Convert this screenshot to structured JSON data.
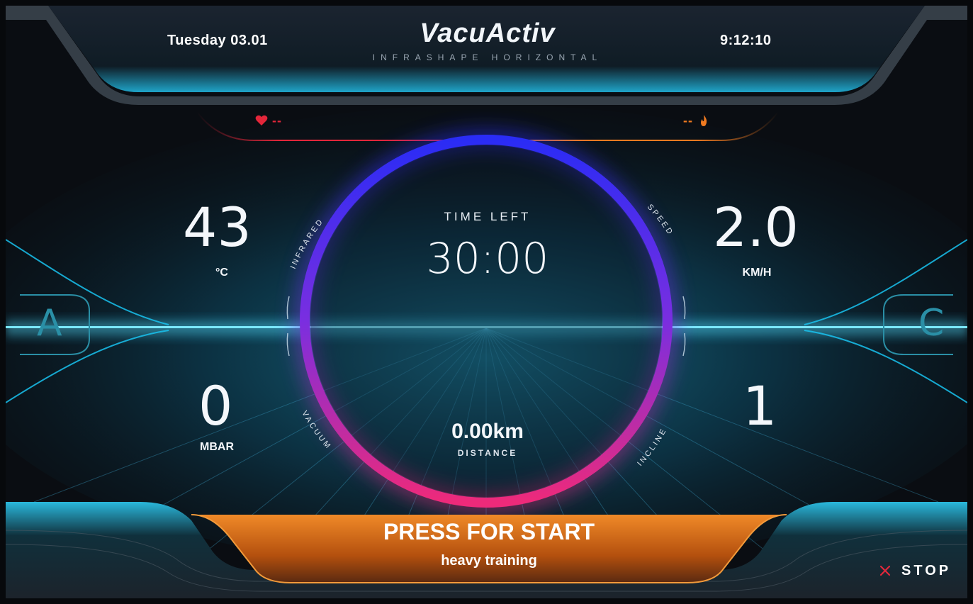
{
  "header": {
    "date": "Tuesday 03.01",
    "time": "9:12:10",
    "logo": "VacuActiv",
    "subtitle": "INFRASHAPE HORIZONTAL"
  },
  "heart_rate": {
    "value": "--",
    "icon": "heart-icon",
    "color": "#e3263a"
  },
  "calories": {
    "value": "--",
    "icon": "flame-icon",
    "color": "#f07a20"
  },
  "gauges": {
    "infrared": {
      "label": "INFRARED",
      "value": "43",
      "unit": "°C"
    },
    "speed": {
      "label": "SPEED",
      "value": "2.0",
      "unit": "KM/H"
    },
    "vacuum": {
      "label": "VACUUM",
      "value": "0",
      "unit": "MBAR"
    },
    "incline": {
      "label": "INCLINE",
      "value": "1"
    }
  },
  "timer": {
    "label": "TIME LEFT",
    "value": "30:00"
  },
  "distance": {
    "value": "0.00km",
    "label": "DISTANCE"
  },
  "side_buttons": {
    "left": "A",
    "right": "C"
  },
  "start_button": {
    "title": "PRESS FOR START",
    "subtitle": "heavy training",
    "color": "#e0741c"
  },
  "stop_button": {
    "label": "STOP",
    "icon": "close-icon",
    "color": "#e0283c"
  },
  "colors": {
    "accent": "#19c3f0",
    "ring_top": "#2a2cf5",
    "ring_bottom": "#ee2a7a"
  }
}
